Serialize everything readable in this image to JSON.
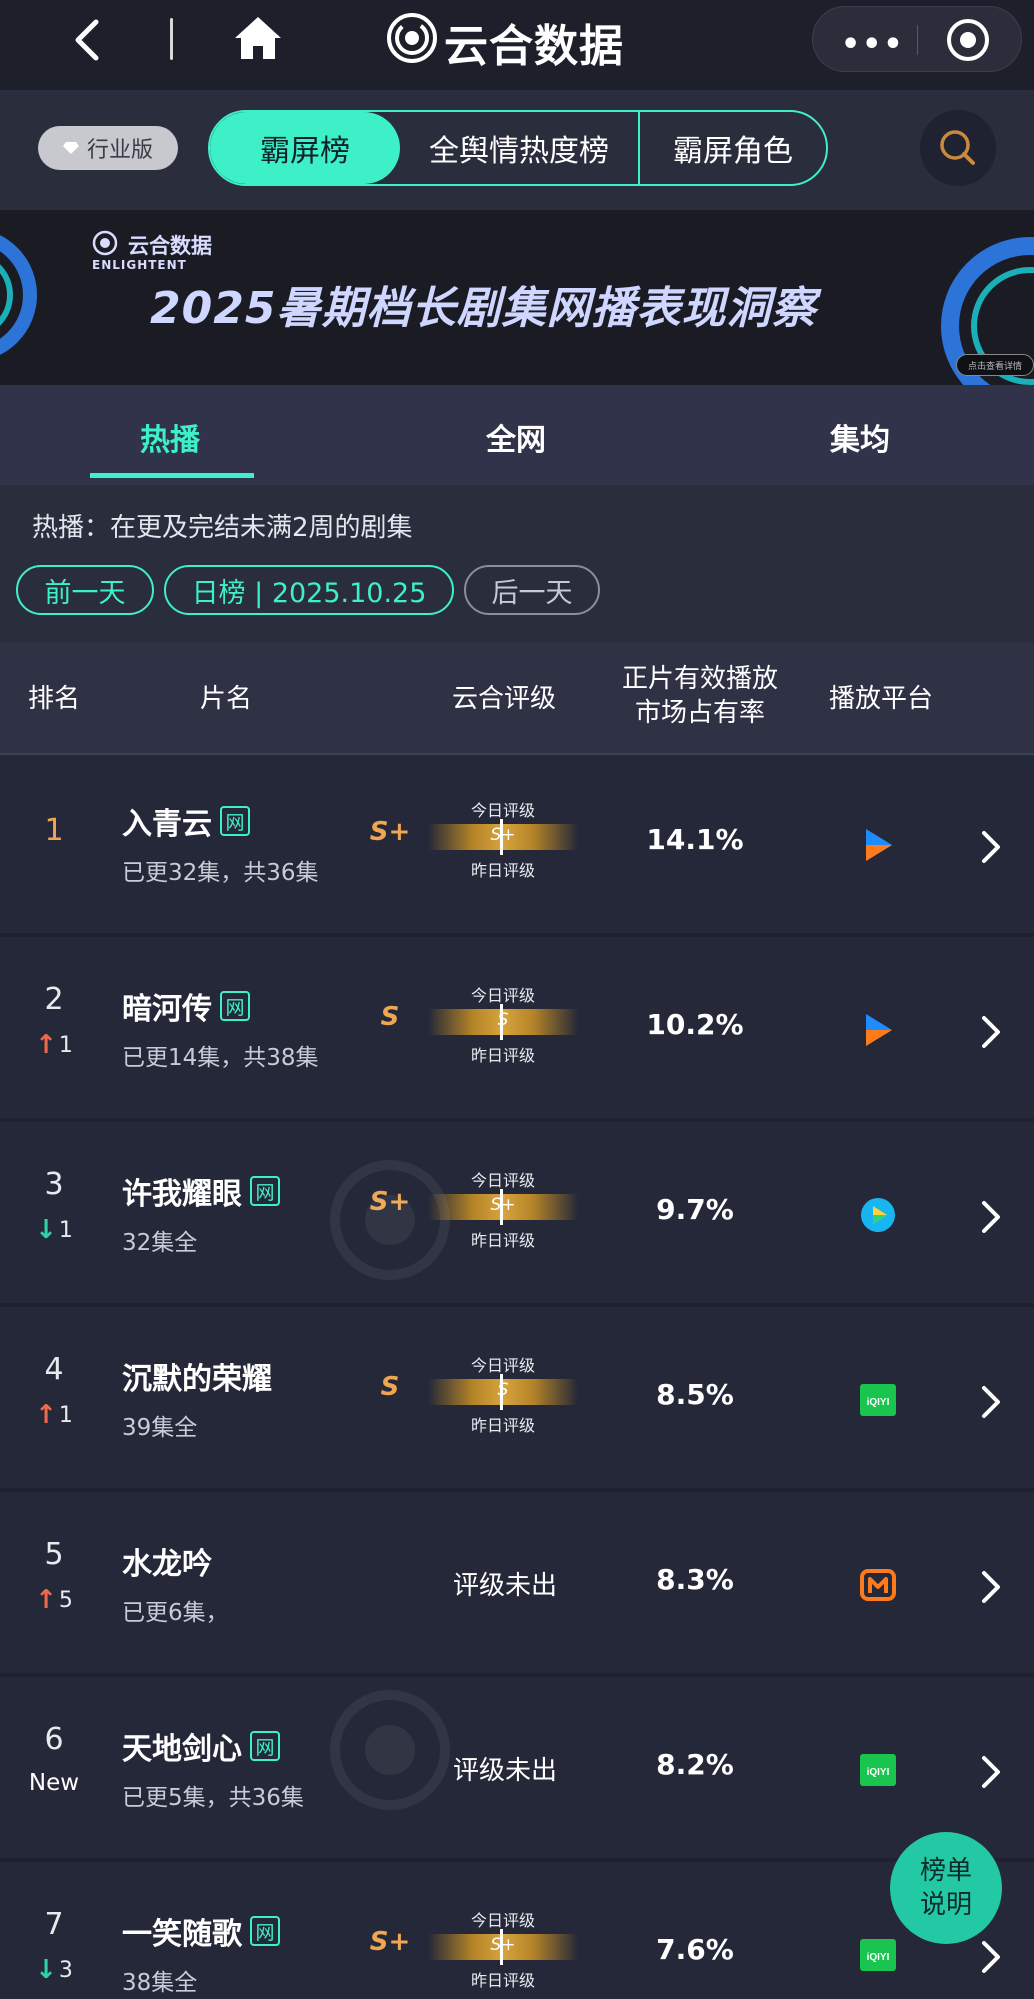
{
  "app": {
    "title": "云合数据",
    "edition_badge": "行业版"
  },
  "rank_tabs": [
    "霸屏榜",
    "全舆情热度榜",
    "霸屏角色"
  ],
  "banner": {
    "brand_cn": "云合数据",
    "brand_en": "ENLIGHTENT",
    "title": "2025暑期档长剧集网播表现洞察",
    "cta": "点击查看详情"
  },
  "scope_tabs": [
    "热播",
    "全网",
    "集均"
  ],
  "filter": {
    "description": "热播：在更及完结未满2周的剧集",
    "prev_day": "前一天",
    "current": "日榜 | 2025.10.25",
    "next_day": "后一天"
  },
  "table": {
    "headers": {
      "rank": "排名",
      "title": "片名",
      "grade": "云合评级",
      "share_line1": "正片有效播放",
      "share_line2": "市场占有率",
      "platform": "播放平台"
    },
    "grade_today_label": "今日评级",
    "grade_yesterday_label": "昨日评级",
    "rows": [
      {
        "rank": "1",
        "change_dir": "",
        "change": "",
        "title": "入青云",
        "web": "网",
        "episodes": "已更32集，共36集",
        "grade": "S+",
        "grade_na": "",
        "share": "14.1%",
        "platform": "tencent-video-icon"
      },
      {
        "rank": "2",
        "change_dir": "up",
        "change": "1",
        "title": "暗河传",
        "web": "网",
        "episodes": "已更14集，共38集",
        "grade": "S",
        "grade_na": "",
        "share": "10.2%",
        "platform": "youku-icon"
      },
      {
        "rank": "3",
        "change_dir": "down",
        "change": "1",
        "title": "许我耀眼",
        "web": "网",
        "episodes": "32集全",
        "grade": "S+",
        "grade_na": "",
        "share": "9.7%",
        "platform": "tencent-video-icon"
      },
      {
        "rank": "4",
        "change_dir": "up",
        "change": "1",
        "title": "沉默的荣耀",
        "web": "",
        "episodes": "39集全",
        "grade": "S",
        "grade_na": "",
        "share": "8.5%",
        "platform": "iqiyi-icon"
      },
      {
        "rank": "5",
        "change_dir": "up",
        "change": "5",
        "title": "水龙吟",
        "web": "",
        "episodes": "已更6集，",
        "grade": "",
        "grade_na": "评级未出",
        "share": "8.3%",
        "platform": "mgtv-icon"
      },
      {
        "rank": "6",
        "change_dir": "new",
        "change": "New",
        "title": "天地剑心",
        "web": "网",
        "episodes": "已更5集，共36集",
        "grade": "",
        "grade_na": "评级未出",
        "share": "8.2%",
        "platform": "iqiyi-icon"
      },
      {
        "rank": "7",
        "change_dir": "down",
        "change": "3",
        "title": "一笑随歌",
        "web": "网",
        "episodes": "38集全",
        "grade": "S+",
        "grade_na": "",
        "share": "7.6%",
        "platform": "iqiyi-icon"
      }
    ]
  },
  "help_button": {
    "line1": "榜单",
    "line2": "说明"
  },
  "colors": {
    "accent": "#3ef0c8",
    "grade": "#f0a650",
    "up": "#ee6a4a",
    "down": "#2fd3a6",
    "background": "#252838"
  }
}
